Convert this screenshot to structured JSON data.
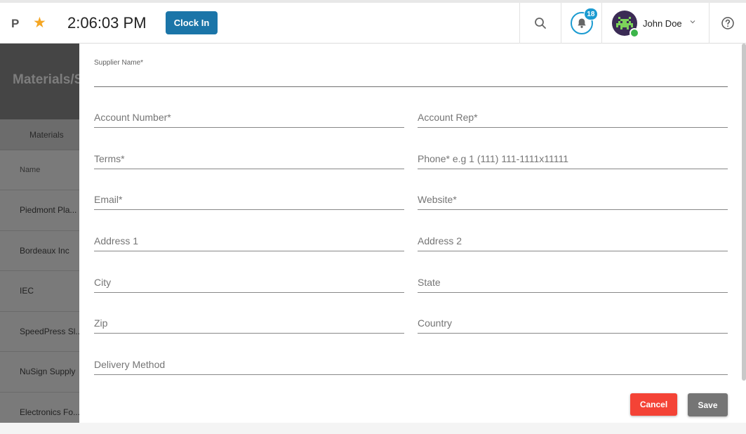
{
  "topbar": {
    "logo": "P",
    "time": "2:06:03 PM",
    "clock_in_label": "Clock In",
    "notification_count": "18",
    "user_name": "John Doe"
  },
  "background": {
    "title": "Materials/Su",
    "tab": "Materials",
    "column_header": "Name",
    "rows": [
      "Piedmont Pla...",
      "Bordeaux Inc",
      "IEC",
      "SpeedPress Sl...",
      "NuSign Supply",
      "Electronics Fo..."
    ]
  },
  "form": {
    "supplier_name": "Supplier Name*",
    "account_number": "Account Number*",
    "account_rep": "Account Rep*",
    "terms": "Terms*",
    "phone": "Phone* e.g 1 (111) 111-1111x11111",
    "email": "Email*",
    "website": "Website*",
    "address1": "Address 1",
    "address2": "Address 2",
    "city": "City",
    "state": "State",
    "zip": "Zip",
    "country": "Country",
    "delivery_method": "Delivery Method",
    "cancel_label": "Cancel",
    "save_label": "Save"
  },
  "colors": {
    "clock_in": "#1b75a8",
    "cancel": "#f44336",
    "save": "#757575",
    "badge": "#1b9bd1",
    "star": "#f5a623"
  }
}
